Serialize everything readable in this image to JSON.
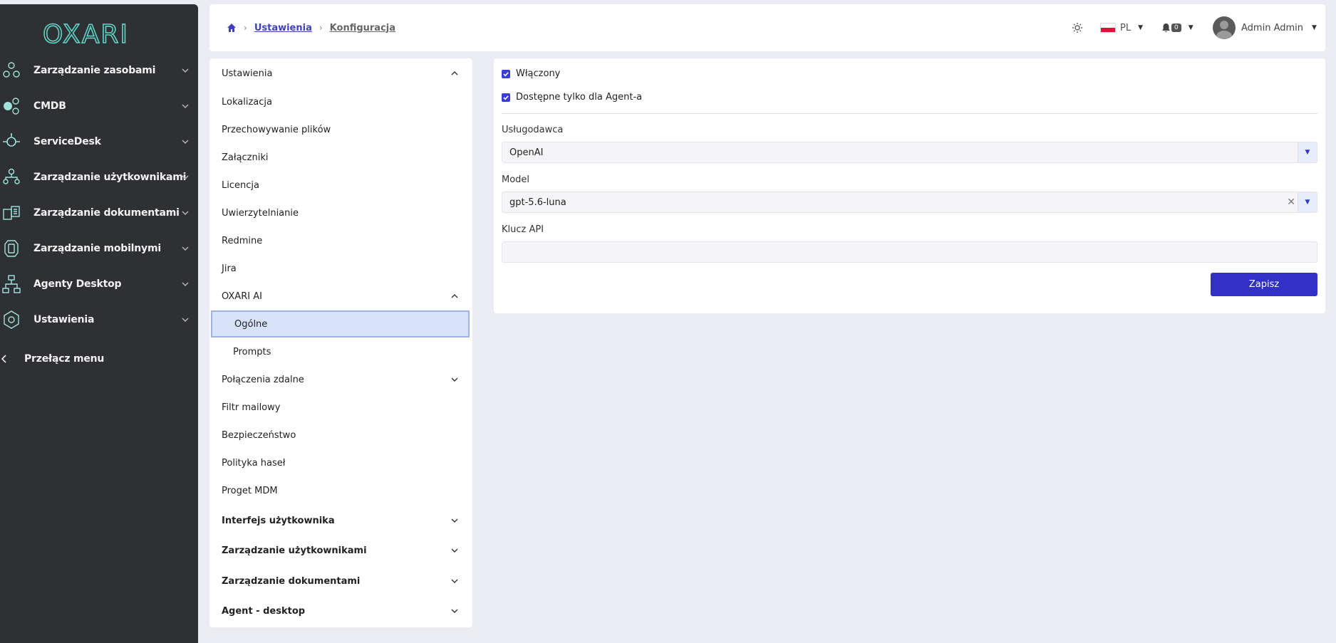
{
  "app": {
    "logo_text": "OXARI"
  },
  "sidebar": {
    "items": [
      {
        "label": "Zarządzanie zasobami",
        "icon": "assets-icon"
      },
      {
        "label": "CMDB",
        "icon": "cmdb-icon"
      },
      {
        "label": "ServiceDesk",
        "icon": "servicedesk-icon"
      },
      {
        "label": "Zarządzanie użytkownikami",
        "icon": "users-icon"
      },
      {
        "label": "Zarządzanie dokumentami",
        "icon": "documents-icon"
      },
      {
        "label": "Zarządzanie mobilnymi",
        "icon": "mobile-icon"
      },
      {
        "label": "Agenty Desktop",
        "icon": "agents-icon"
      },
      {
        "label": "Ustawienia",
        "icon": "settings-icon"
      }
    ],
    "toggle_label": "Przełącz menu"
  },
  "header": {
    "breadcrumb": [
      "Ustawienia",
      "Konfiguracja"
    ],
    "language": "PL",
    "notifications_count": "0",
    "user_name": "Admin Admin"
  },
  "settings_menu": {
    "header": "Ustawienia",
    "items": [
      "Lokalizacja",
      "Przechowywanie plików",
      "Załączniki",
      "Licencja",
      "Uwierzytelnianie",
      "Redmine",
      "Jira",
      "OXARI AI",
      "Ogólne",
      "Prompts",
      "Połączenia zdalne",
      "Filtr mailowy",
      "Bezpieczeństwo",
      "Polityka haseł",
      "Proget MDM",
      "Interfejs użytkownika",
      "Zarządzanie użytkownikami",
      "Zarządzanie dokumentami",
      "Agent - desktop"
    ]
  },
  "form": {
    "enabled_label": "Włączony",
    "enabled_checked": true,
    "agent_only_label": "Dostępne tylko dla Agent-a",
    "agent_only_checked": true,
    "provider_label": "Usługodawca",
    "provider_value": "OpenAI",
    "model_label": "Model",
    "model_value": "gpt-5.6-luna",
    "api_key_label": "Klucz API",
    "api_key_value": "",
    "save_label": "Zapisz"
  },
  "colors": {
    "sidebar_bg": "#2e3033",
    "accent": "#3131c8",
    "logo": "#5fd3c6",
    "active_item_bg": "#d6e3fa"
  }
}
